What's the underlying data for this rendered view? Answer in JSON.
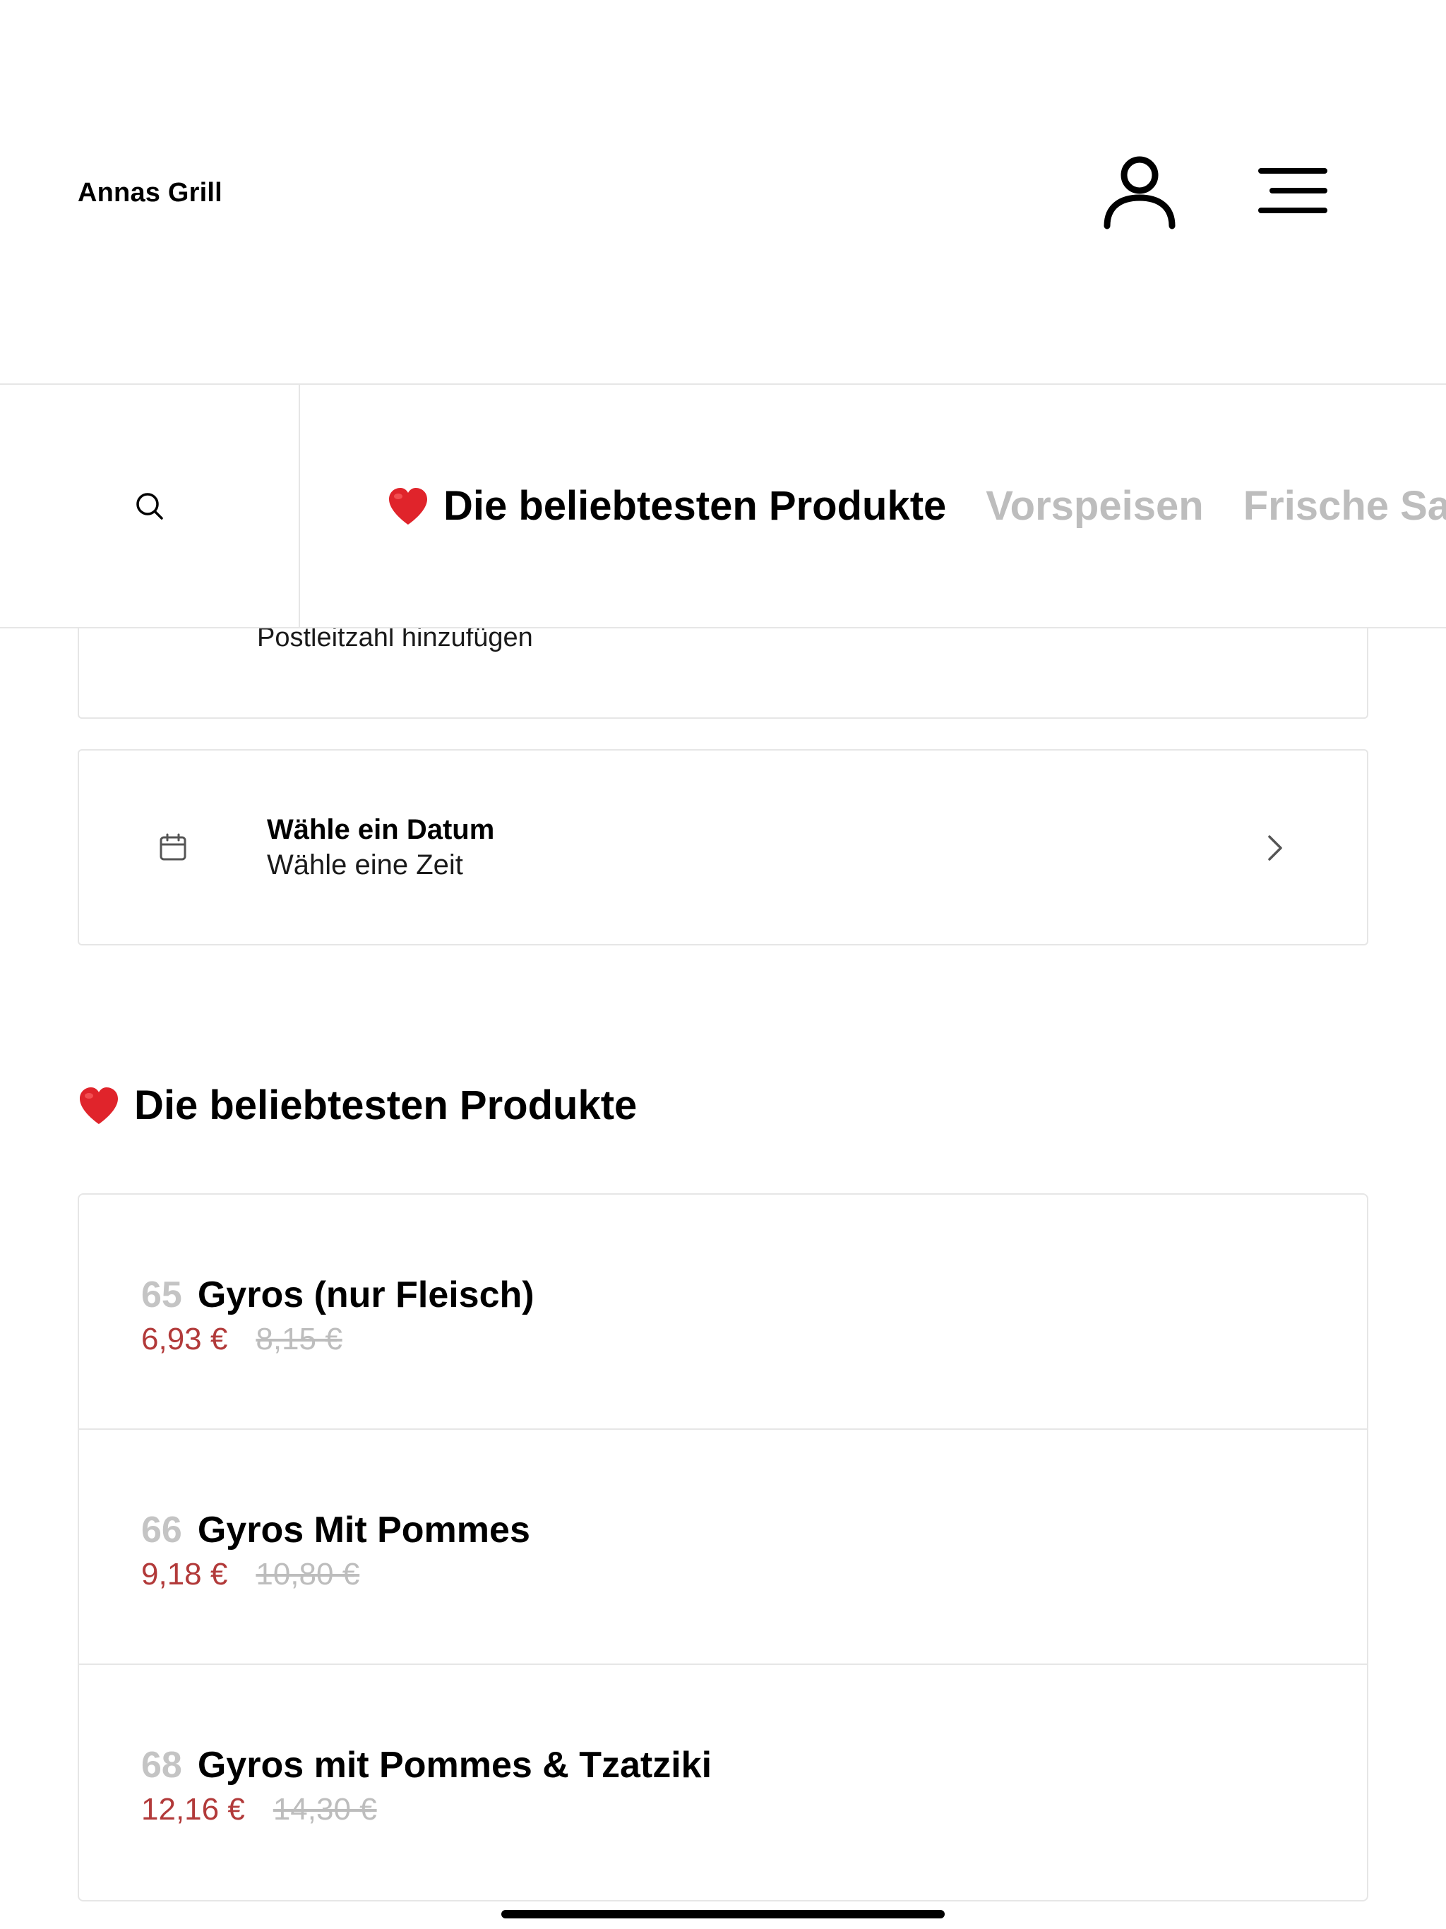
{
  "app": {
    "brand": "Annas Grill"
  },
  "categories": [
    {
      "label": "Die beliebtesten Produkte",
      "active": true,
      "icon": "heart-icon"
    },
    {
      "label": "Vorspeisen",
      "active": false
    },
    {
      "label": "Frische Sa",
      "active": false
    }
  ],
  "delivery": {
    "postal_label": "Postleitzahl hinzufügen",
    "date_title": "Wähle ein Datum",
    "date_subtitle": "Wähle eine Zeit"
  },
  "section": {
    "title": "Die beliebtesten Produkte",
    "icon": "heart-icon"
  },
  "products": [
    {
      "number": "65",
      "name": "Gyros (nur Fleisch)",
      "price": "6,93 €",
      "old_price": "8,15 €"
    },
    {
      "number": "66",
      "name": "Gyros Mit Pommes",
      "price": "9,18 €",
      "old_price": "10,80 €"
    },
    {
      "number": "68",
      "name": "Gyros mit Pommes & Tzatziki",
      "price": "12,16 €",
      "old_price": "14,30 €"
    }
  ],
  "colors": {
    "accent_red": "#b23a3a",
    "heart_red": "#e0242b",
    "muted_gray": "#bdbdbd",
    "border": "#e6e6e6"
  }
}
